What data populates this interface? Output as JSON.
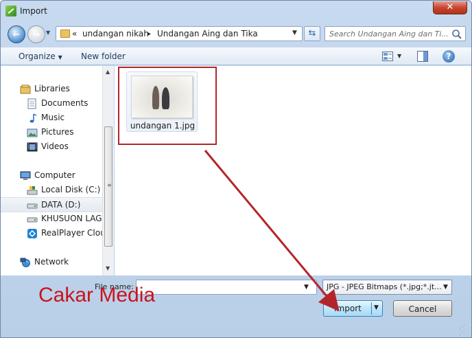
{
  "window": {
    "title": "Import"
  },
  "title_bar": {
    "close_glyph": "✕"
  },
  "address": {
    "overflow_glyph": "«",
    "segments": [
      "undangan nikah",
      "Undangan Aing dan Tika"
    ],
    "separator": "▸"
  },
  "search": {
    "placeholder": "Search Undangan Aing dan Ti..."
  },
  "toolbar": {
    "organize_label": "Organize",
    "new_folder_label": "New folder",
    "help_glyph": "?"
  },
  "nav": {
    "items": [
      {
        "label": "Libraries",
        "icon": "libraries-icon"
      },
      {
        "label": "Documents",
        "icon": "documents-icon"
      },
      {
        "label": "Music",
        "icon": "music-icon"
      },
      {
        "label": "Pictures",
        "icon": "pictures-icon"
      },
      {
        "label": "Videos",
        "icon": "videos-icon"
      },
      {
        "label": "Computer",
        "icon": "computer-icon"
      },
      {
        "label": "Local Disk (C:)",
        "icon": "local-disk-icon"
      },
      {
        "label": "DATA (D:)",
        "icon": "drive-icon"
      },
      {
        "label": "KHUSUON LAGU",
        "icon": "drive-icon"
      },
      {
        "label": "RealPlayer Cloud",
        "icon": "realplayer-icon"
      },
      {
        "label": "Network",
        "icon": "network-icon"
      }
    ],
    "selected": "DATA (D:)"
  },
  "files": [
    {
      "name": "undangan 1.jpg",
      "icon": "image-thumbnail"
    }
  ],
  "bottom": {
    "filename_label": "File name:",
    "filename_value": "",
    "filetype_value": "JPG - JPEG Bitmaps (*.jpg;*.jt...",
    "import_label": "Import",
    "cancel_label": "Cancel"
  },
  "watermark": {
    "text": "Cakar Media"
  },
  "colors": {
    "annotation": "#b3252a",
    "watermark": "#c8141c",
    "accent": "#3c7fb1"
  }
}
